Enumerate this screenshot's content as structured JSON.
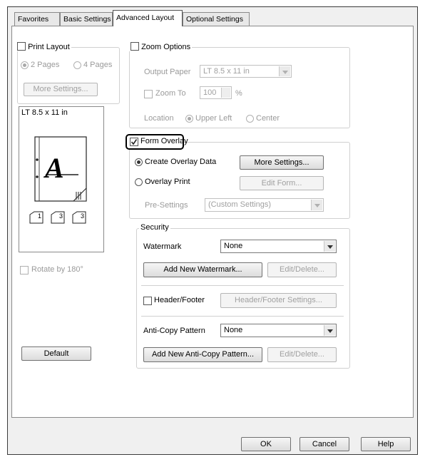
{
  "tabs": [
    {
      "label": "Favorites"
    },
    {
      "label": "Basic Settings"
    },
    {
      "label": "Advanced Layout"
    },
    {
      "label": "Optional Settings"
    }
  ],
  "print_layout": {
    "label": "Print Layout",
    "checked": false,
    "options": [
      "2 Pages",
      "4 Pages"
    ],
    "more_settings": "More Settings..."
  },
  "preview": {
    "paper": "LT 8.5 x 11 in",
    "letter": "A",
    "copy_marks": [
      "1",
      "3",
      "3"
    ]
  },
  "rotate": {
    "label": "Rotate by 180°"
  },
  "default_button": "Default",
  "zoom": {
    "label": "Zoom Options",
    "output_paper_label": "Output Paper",
    "output_paper_value": "LT 8.5 x 11 in",
    "zoom_to_label": "Zoom To",
    "zoom_value": "100",
    "zoom_unit": "%",
    "location_label": "Location",
    "upper_left": "Upper Left",
    "center": "Center"
  },
  "form_overlay": {
    "label": "Form Overlay",
    "checked": true,
    "create_label": "Create Overlay Data",
    "more_settings": "More Settings...",
    "overlay_print_label": "Overlay Print",
    "edit_form": "Edit Form...",
    "pre_settings_label": "Pre-Settings",
    "pre_settings_value": "(Custom Settings)"
  },
  "security": {
    "label": "Security",
    "watermark_label": "Watermark",
    "watermark_value": "None",
    "add_watermark": "Add New Watermark...",
    "edit_delete": "Edit/Delete...",
    "header_footer_label": "Header/Footer",
    "header_footer_settings": "Header/Footer Settings...",
    "anti_copy_label": "Anti-Copy Pattern",
    "anti_copy_value": "None",
    "add_anti_copy": "Add New Anti-Copy Pattern...",
    "edit_delete2": "Edit/Delete..."
  },
  "footer": {
    "ok": "OK",
    "cancel": "Cancel",
    "help": "Help"
  },
  "colors": {
    "highlight_border": "#000000",
    "panel": "#ffffff",
    "dialog": "#f0f0f0"
  }
}
